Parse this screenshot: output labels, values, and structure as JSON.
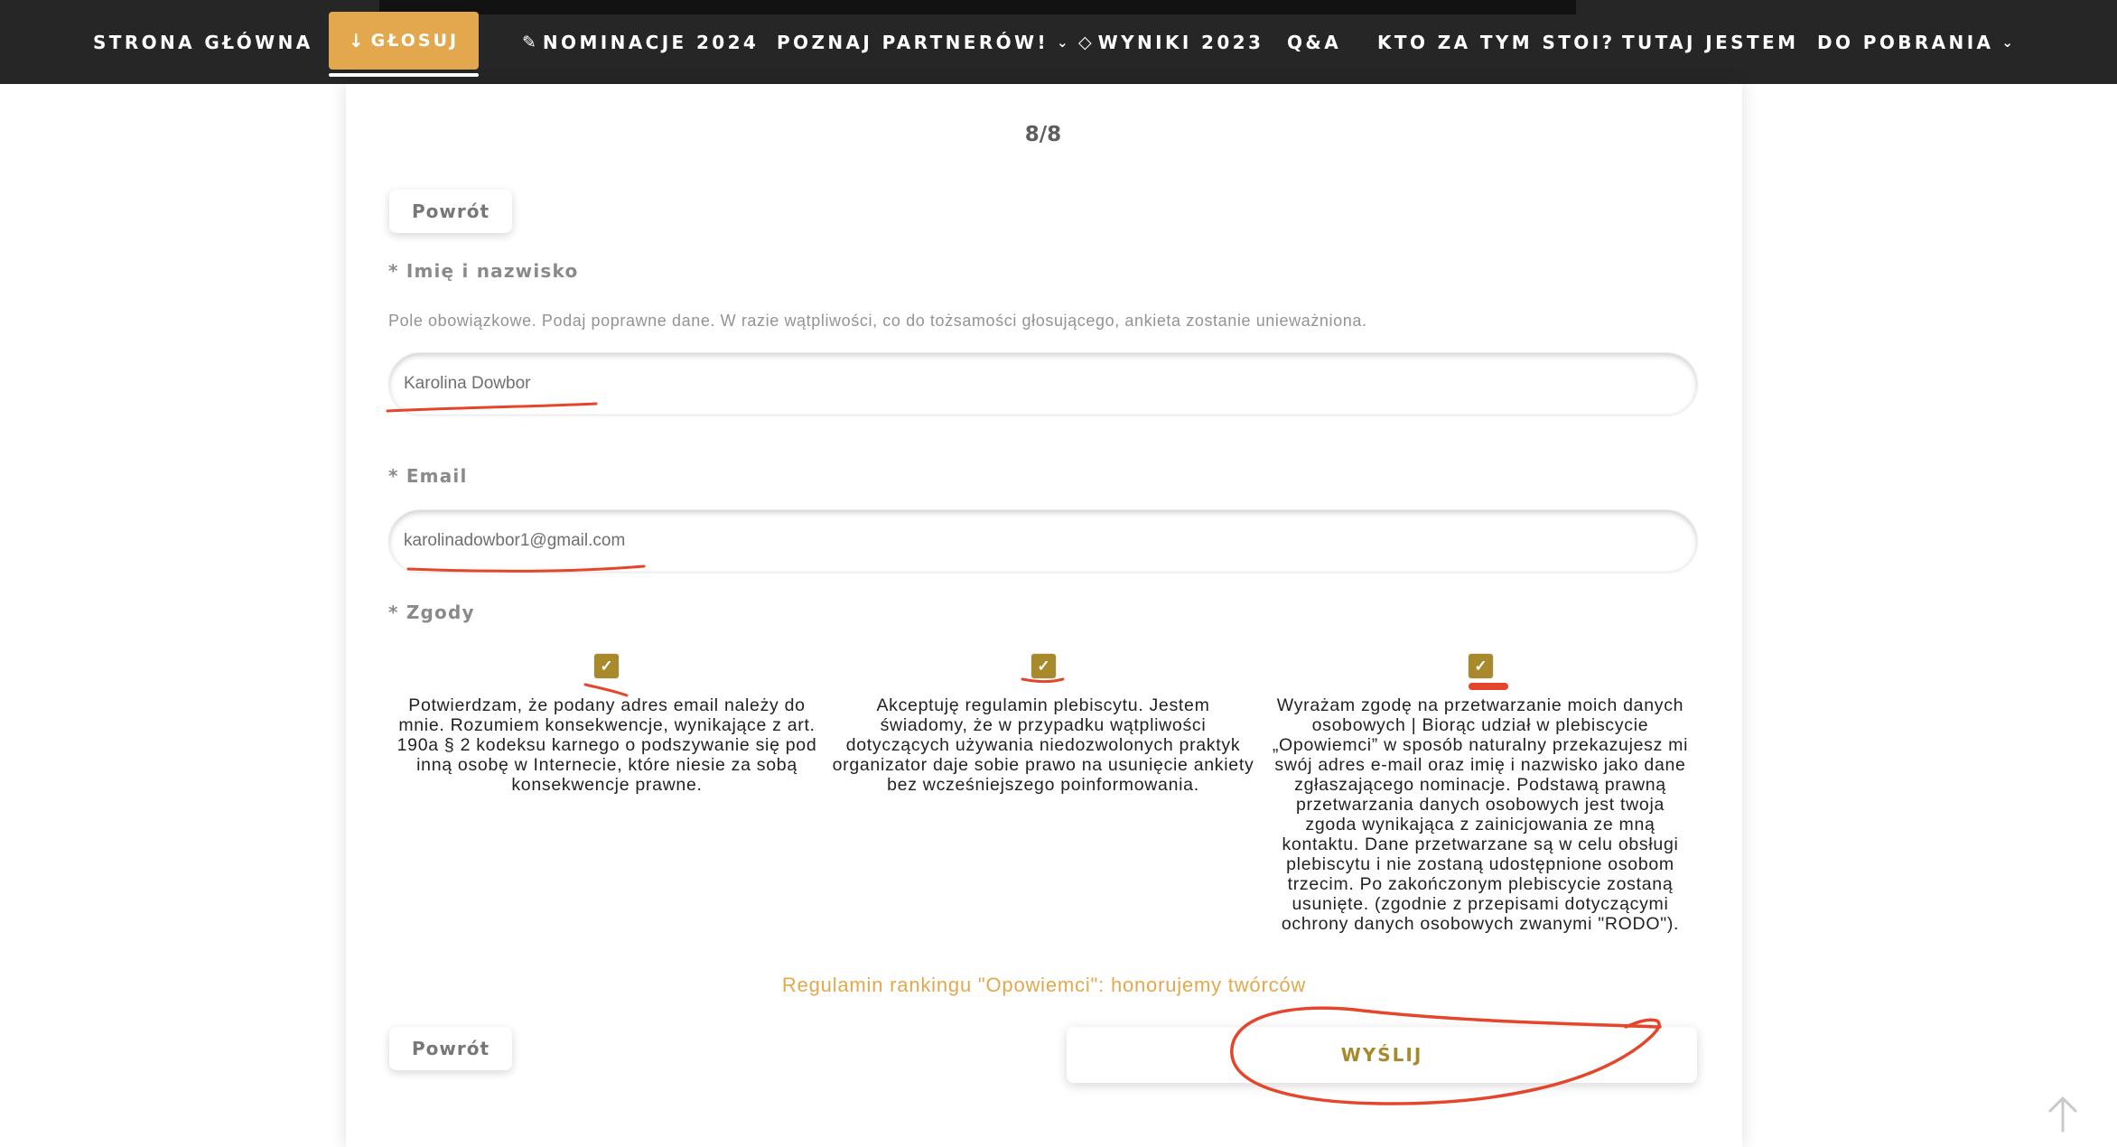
{
  "nav": {
    "items": [
      {
        "label": "STRONA GŁÓWNA",
        "icon": ""
      },
      {
        "label": "NOMINACJE 2024",
        "icon": "pencil-icon"
      },
      {
        "label": "POZNAJ PARTNERÓW!",
        "icon": "",
        "dropdown": true
      },
      {
        "label": "WYNIKI 2023",
        "icon": "diamond-icon"
      },
      {
        "label": "Q&A",
        "icon": ""
      },
      {
        "label": "KTO ZA TYM STOI?",
        "icon": ""
      },
      {
        "label": "TUTAJ JESTEM",
        "icon": ""
      },
      {
        "label": "DO POBRANIA",
        "icon": "",
        "dropdown": true
      }
    ],
    "vote_label": "GŁOSUJ",
    "vote_icon": "arrow-down-icon"
  },
  "form": {
    "progress": "8/8",
    "back_label": "Powrót",
    "name_label": "* Imię i nazwisko",
    "name_hint": "Pole obowiązkowe. Podaj poprawne dane. W razie wątpliwości, co do tożsamości głosującego, ankieta zostanie unieważniona.",
    "name_value": "Karolina Dowbor",
    "email_label": "* Email",
    "email_value": "karolinadowbor1@gmail.com",
    "consents_label": "* Zgody",
    "consents": [
      {
        "checked": true,
        "lines": [
          "Potwierdzam, że podany adres email należy do",
          "mnie. Rozumiem konsekwencje, wynikające z art.",
          "190a § 2 kodeksu karnego o podszywanie się pod",
          "inną osobę w Internecie, które niesie za sobą",
          "konsekwencje prawne."
        ]
      },
      {
        "checked": true,
        "lines": [
          "Akceptuję regulamin plebiscytu. Jestem",
          "świadomy, że w przypadku wątpliwości",
          "dotyczących używania niedozwolonych praktyk",
          "organizator daje sobie prawo na usunięcie ankiety",
          "bez wcześniejszego poinformowania."
        ]
      },
      {
        "checked": true,
        "lines": [
          "Wyrażam zgodę na przetwarzanie moich danych",
          "osobowych | Biorąc udział w plebiscycie",
          "„Opowiemci” w sposób naturalny przekazujesz mi",
          "swój adres e-mail oraz imię i nazwisko jako dane",
          "zgłaszającego nominacje. Podstawą prawną",
          "przetwarzania danych osobowych jest twoja",
          "zgoda wynikająca z zainicjowania ze mną",
          "kontaktu. Dane przetwarzane są w celu obsługi",
          "plebiscytu i nie zostaną udostępnione osobom",
          "trzecim. Po zakończonym plebiscycie zostaną",
          "usunięte. (zgodnie z przepisami dotyczącymi",
          "ochrony danych osobowych zwanymi \"RODO\")."
        ]
      }
    ],
    "rules_link": "Regulamin rankingu \"Opowiemci\": honorujemy twórców",
    "submit_label": "WYŚLIJ"
  },
  "colors": {
    "nav_bg": "#262626",
    "accent_gold": "#e3a84d",
    "checkbox_gold": "#a88a2c",
    "annotation_red": "#e5452a"
  },
  "icons": {
    "check": "checkmark-icon",
    "scroll_top": "arrow-up-icon"
  }
}
